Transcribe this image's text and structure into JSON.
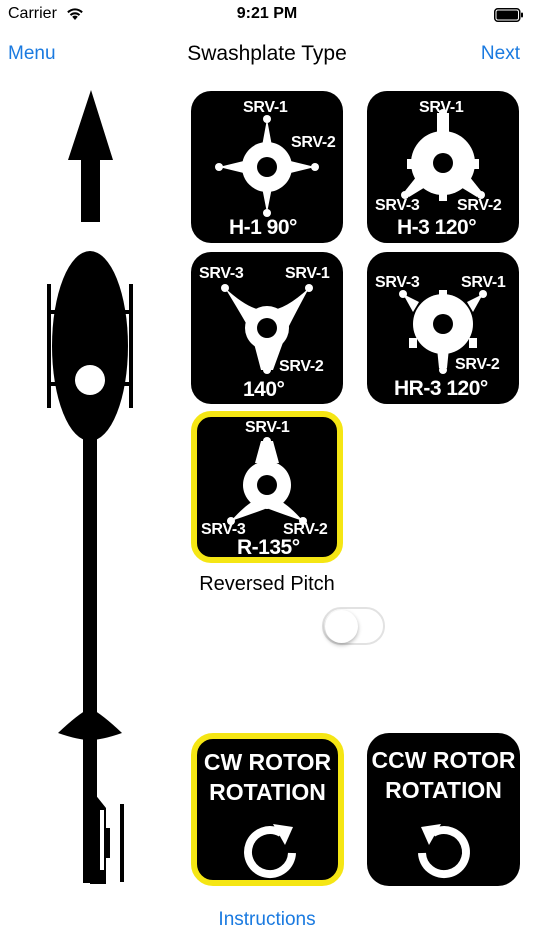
{
  "status": {
    "carrier": "Carrier",
    "time": "9:21 PM"
  },
  "nav": {
    "left": "Menu",
    "title": "Swashplate Type",
    "right": "Next"
  },
  "swash": {
    "h1": {
      "srv1": "SRV-1",
      "srv2": "SRV-2",
      "caption": "H-1 90°"
    },
    "h3": {
      "srv1": "SRV-1",
      "srv3": "SRV-3",
      "srv2": "SRV-2",
      "caption": "H-3 120°"
    },
    "s140": {
      "srv3": "SRV-3",
      "srv1": "SRV-1",
      "srv2": "SRV-2",
      "caption": "140°"
    },
    "hr3": {
      "srv3": "SRV-3",
      "srv1": "SRV-1",
      "srv2": "SRV-2",
      "caption": "HR-3 120°"
    },
    "r135": {
      "srv1": "SRV-1",
      "srv3": "SRV-3",
      "srv2": "SRV-2",
      "caption": "R-135°"
    }
  },
  "reversed_pitch": {
    "label": "Reversed Pitch",
    "on": false
  },
  "rotation": {
    "cw": {
      "line1": "CW ROTOR",
      "line2": "ROTATION",
      "selected": true
    },
    "ccw": {
      "line1": "CCW ROTOR",
      "line2": "ROTATION",
      "selected": false
    }
  },
  "footer": {
    "instructions": "Instructions"
  },
  "colors": {
    "accent": "#1a7ae0",
    "selection": "#f5e614",
    "tile": "#000000"
  },
  "icons": [
    "wifi-icon",
    "battery-icon",
    "direction-arrow-icon",
    "helicopter-icon",
    "clockwise-icon",
    "counterclockwise-icon"
  ]
}
